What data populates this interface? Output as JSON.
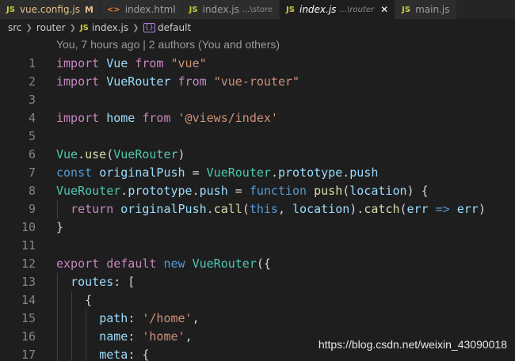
{
  "tabs": [
    {
      "icon": "JS",
      "name": "vue.config.js",
      "badge": "M",
      "desc": "",
      "active": false
    },
    {
      "icon": "<>",
      "name": "index.html",
      "badge": "",
      "desc": "",
      "active": false
    },
    {
      "icon": "JS",
      "name": "index.js",
      "badge": "",
      "desc": "...\\store",
      "active": false
    },
    {
      "icon": "JS",
      "name": "index.js",
      "badge": "",
      "desc": "...\\router",
      "active": true
    },
    {
      "icon": "JS",
      "name": "main.js",
      "badge": "",
      "desc": "",
      "active": false
    }
  ],
  "breadcrumb": {
    "src": "src",
    "router": "router",
    "file_icon": "JS",
    "file": "index.js",
    "symbol": "default"
  },
  "blame": "You, 7 hours ago | 2 authors (You and others)",
  "line_numbers": [
    "1",
    "2",
    "3",
    "4",
    "5",
    "6",
    "7",
    "8",
    "9",
    "10",
    "11",
    "12",
    "13",
    "14",
    "15",
    "16",
    "17"
  ],
  "code_lines": [
    [
      [
        "kw-ctrl",
        "import"
      ],
      [
        "pun",
        " "
      ],
      [
        "var",
        "Vue"
      ],
      [
        "pun",
        " "
      ],
      [
        "kw-ctrl",
        "from"
      ],
      [
        "pun",
        " "
      ],
      [
        "str",
        "\"vue\""
      ]
    ],
    [
      [
        "kw-ctrl",
        "import"
      ],
      [
        "pun",
        " "
      ],
      [
        "var",
        "VueRouter"
      ],
      [
        "pun",
        " "
      ],
      [
        "kw-ctrl",
        "from"
      ],
      [
        "pun",
        " "
      ],
      [
        "str",
        "\"vue-router\""
      ]
    ],
    [],
    [
      [
        "kw-ctrl",
        "import"
      ],
      [
        "pun",
        " "
      ],
      [
        "var",
        "home"
      ],
      [
        "pun",
        " "
      ],
      [
        "kw-ctrl",
        "from"
      ],
      [
        "pun",
        " "
      ],
      [
        "str",
        "'@views/index'"
      ]
    ],
    [],
    [
      [
        "cls",
        "Vue"
      ],
      [
        "pun",
        "."
      ],
      [
        "fn",
        "use"
      ],
      [
        "pun",
        "("
      ],
      [
        "cls",
        "VueRouter"
      ],
      [
        "pun",
        ")"
      ]
    ],
    [
      [
        "kw",
        "const"
      ],
      [
        "pun",
        " "
      ],
      [
        "var",
        "originalPush"
      ],
      [
        "pun",
        " = "
      ],
      [
        "cls",
        "VueRouter"
      ],
      [
        "pun",
        "."
      ],
      [
        "var",
        "prototype"
      ],
      [
        "pun",
        "."
      ],
      [
        "var",
        "push"
      ]
    ],
    [
      [
        "cls",
        "VueRouter"
      ],
      [
        "pun",
        "."
      ],
      [
        "var",
        "prototype"
      ],
      [
        "pun",
        "."
      ],
      [
        "var",
        "push"
      ],
      [
        "pun",
        " = "
      ],
      [
        "kw",
        "function"
      ],
      [
        "pun",
        " "
      ],
      [
        "fn",
        "push"
      ],
      [
        "pun",
        "("
      ],
      [
        "var",
        "location"
      ],
      [
        "pun",
        ") {"
      ]
    ],
    [
      [
        "pun",
        "  "
      ],
      [
        "kw-ctrl",
        "return"
      ],
      [
        "pun",
        " "
      ],
      [
        "var",
        "originalPush"
      ],
      [
        "pun",
        "."
      ],
      [
        "fn",
        "call"
      ],
      [
        "pun",
        "("
      ],
      [
        "kw",
        "this"
      ],
      [
        "pun",
        ", "
      ],
      [
        "var",
        "location"
      ],
      [
        "pun",
        ")."
      ],
      [
        "fn",
        "catch"
      ],
      [
        "pun",
        "("
      ],
      [
        "var",
        "err"
      ],
      [
        "pun",
        " "
      ],
      [
        "kw",
        "=>"
      ],
      [
        "pun",
        " "
      ],
      [
        "var",
        "err"
      ],
      [
        "pun",
        ")"
      ]
    ],
    [
      [
        "pun",
        "}"
      ]
    ],
    [],
    [
      [
        "kw-ctrl",
        "export"
      ],
      [
        "pun",
        " "
      ],
      [
        "kw-ctrl",
        "default"
      ],
      [
        "pun",
        " "
      ],
      [
        "kw",
        "new"
      ],
      [
        "pun",
        " "
      ],
      [
        "cls",
        "VueRouter"
      ],
      [
        "pun",
        "({"
      ]
    ],
    [
      [
        "pun",
        "  "
      ],
      [
        "var",
        "routes"
      ],
      [
        "pun",
        ": ["
      ]
    ],
    [
      [
        "pun",
        "    {"
      ]
    ],
    [
      [
        "pun",
        "      "
      ],
      [
        "var",
        "path"
      ],
      [
        "pun",
        ": "
      ],
      [
        "str",
        "'/home'"
      ],
      [
        "pun",
        ","
      ]
    ],
    [
      [
        "pun",
        "      "
      ],
      [
        "var",
        "name"
      ],
      [
        "pun",
        ": "
      ],
      [
        "str",
        "'home'"
      ],
      [
        "pun",
        ","
      ]
    ],
    [
      [
        "pun",
        "      "
      ],
      [
        "var",
        "meta"
      ],
      [
        "pun",
        ": {"
      ]
    ]
  ],
  "watermark": "https://blog.csdn.net/weixin_43090018"
}
